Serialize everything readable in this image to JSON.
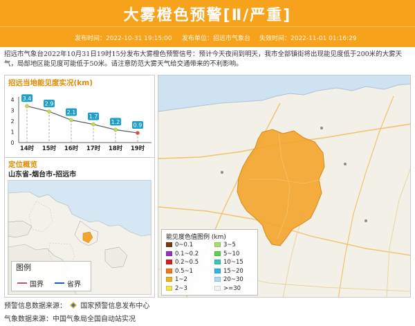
{
  "header": {
    "title": "大雾橙色预警[Ⅱ/严重]",
    "publish_time": "发布时间：2022-10-31 19:15:00",
    "publisher": "发布单位：招远市气象台",
    "expire_time": "失效时间：2022-11-01 01:16:29",
    "color": "#f6a21a"
  },
  "description": "招远市气象台2022年10月31日19时15分发布大雾橙色预警信号：预计今天夜间到明天，我市全部镇街将出现能见度低于200米的大雾天气，局部地区能见度可能低于50米。请注意防范大雾天气给交通带来的不利影响。",
  "chart_data": {
    "type": "line",
    "title": "招远当地能见度实况(km)",
    "categories": [
      "14时",
      "15时",
      "16时",
      "17时",
      "18时",
      "19时"
    ],
    "values": [
      3.4,
      2.9,
      2.1,
      1.7,
      1.2,
      0.9
    ],
    "y_ticks": [
      "0",
      "1",
      "2",
      "3",
      "4"
    ],
    "ylim": [
      0,
      4
    ],
    "grid": "vertical-dashed",
    "label_color": "#1f9fc7"
  },
  "overview": {
    "title": "定位概览",
    "region": "山东省-烟台市-招远市",
    "legend_title": "图例",
    "legend_items": [
      {
        "label": "国界",
        "color": "#c0506a"
      },
      {
        "label": "省界",
        "color": "#2255cc"
      }
    ]
  },
  "map_legend": {
    "title": "能见度色值图例 (km)",
    "items": [
      {
        "label": "0~0.1",
        "color": "#7a3a10"
      },
      {
        "label": "3~5",
        "color": "#a6e06a"
      },
      {
        "label": "0.1~0.2",
        "color": "#9b30c8"
      },
      {
        "label": "5~10",
        "color": "#5fd14a"
      },
      {
        "label": "0.2~0.5",
        "color": "#e01a1a"
      },
      {
        "label": "10~15",
        "color": "#38c9b0"
      },
      {
        "label": "0.5~1",
        "color": "#f07a10"
      },
      {
        "label": "15~20",
        "color": "#2fb6e8"
      },
      {
        "label": "1~2",
        "color": "#f3b21f"
      },
      {
        "label": "20~30",
        "color": "#a9ddf0"
      },
      {
        "label": "2~3",
        "color": "#f1e64a"
      },
      {
        "label": ">=30",
        "color": "#f4f4f4"
      }
    ]
  },
  "footer": {
    "source1_label": "预警信息数据来源：",
    "source1_value": "国家预警信息发布中心",
    "source2": "气象数据来源：中国气象局全国自动站实况"
  }
}
